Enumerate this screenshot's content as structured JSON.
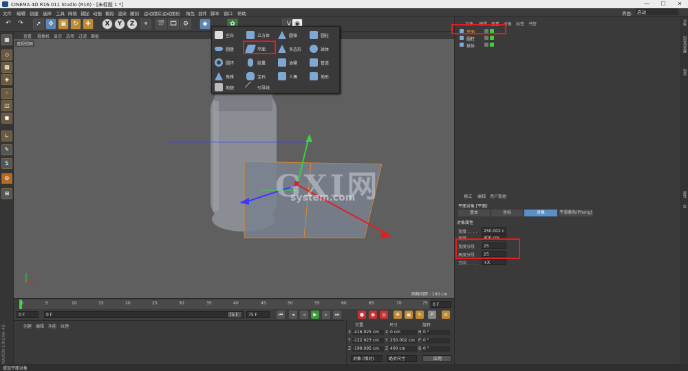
{
  "window": {
    "title": "CINEMA 4D R16.011 Studio (R16) - [未标题 1 *]",
    "min": "—",
    "max": "☐",
    "close": "✕"
  },
  "menu": [
    "文件",
    "编辑",
    "创建",
    "选择",
    "工具",
    "网格",
    "捕捉",
    "动画",
    "模拟",
    "渲染",
    "雕刻",
    "运动跟踪",
    "运动图形",
    "角色",
    "插件",
    "脚本",
    "窗口",
    "帮助"
  ],
  "layout": {
    "label": "界面:",
    "value": "启动"
  },
  "viewport": {
    "menu": [
      "查看",
      "摄像机",
      "显示",
      "选项",
      "过滤",
      "面板"
    ],
    "label": "透视视图",
    "grid": "网格间距 : 100 cm"
  },
  "popup": {
    "items": [
      {
        "label": "空白"
      },
      {
        "label": "立方体"
      },
      {
        "label": "圆锥"
      },
      {
        "label": "圆柱"
      },
      {
        "label": "圆盘"
      },
      {
        "label": "平面"
      },
      {
        "label": "多边形"
      },
      {
        "label": "球体"
      },
      {
        "label": "圆环"
      },
      {
        "label": "胶囊"
      },
      {
        "label": "油桶"
      },
      {
        "label": "管道"
      },
      {
        "label": "角锥"
      },
      {
        "label": "宝石"
      },
      {
        "label": "人偶"
      },
      {
        "label": "地形"
      },
      {
        "label": "地貌"
      },
      {
        "label": "引导线"
      }
    ]
  },
  "objects": {
    "menu": [
      "文件",
      "编辑",
      "查看",
      "对象",
      "标签",
      "书签"
    ],
    "rows": [
      {
        "name": "平面"
      },
      {
        "name": "圆柱"
      },
      {
        "name": "球体"
      }
    ]
  },
  "attributes": {
    "menu": [
      "模式",
      "编辑",
      "用户数据"
    ],
    "title": "平面对象 [平面]",
    "tabs": [
      "基本",
      "坐标",
      "对象",
      "平滑着色(Phong)"
    ],
    "section": "对象属性",
    "props": [
      {
        "key": "宽度 . . . .",
        "value": "250.002 c"
      },
      {
        "key": "高度 . . . .",
        "value": "400 cm"
      },
      {
        "key": "宽度分段",
        "value": "25"
      },
      {
        "key": "高度分段",
        "value": "25"
      },
      {
        "key": "方向 . . . .",
        "value": "+X"
      }
    ]
  },
  "timeline": {
    "ticks": [
      "0",
      "5",
      "10",
      "15",
      "20",
      "25",
      "30",
      "35",
      "40",
      "45",
      "50",
      "55",
      "60",
      "65",
      "70",
      "75"
    ],
    "end_frame": "0 F",
    "start": "0 F",
    "current": "0 F",
    "max1": "75 F",
    "max2": "75 F"
  },
  "materials": {
    "menu": [
      "创建",
      "编辑",
      "功能",
      "纹理"
    ]
  },
  "coords": {
    "headers": [
      "位置",
      "尺寸",
      "旋转"
    ],
    "rows": [
      {
        "a": "X",
        "p": "-416.925 cm",
        "sa": "X",
        "s": "0 cm",
        "ra": "H",
        "r": "0 °"
      },
      {
        "a": "Y",
        "p": "-122.923 cm",
        "sa": "Y",
        "s": "250.002 cm",
        "ra": "P",
        "r": "0 °"
      },
      {
        "a": "Z",
        "p": "-199.095 cm",
        "sa": "Z",
        "s": "400 cm",
        "ra": "B",
        "r": "0 °"
      }
    ],
    "mode": "对象 (相对)",
    "size_mode": "绝对尺寸",
    "apply": "应用"
  },
  "status": "增加平面对象",
  "watermark": {
    "main": "GXI网",
    "sub": "system.com"
  },
  "brand": "MAXON CINEMA 4D",
  "right_strip": [
    "对象",
    "内容浏览器",
    "构造",
    "属性",
    "层"
  ]
}
